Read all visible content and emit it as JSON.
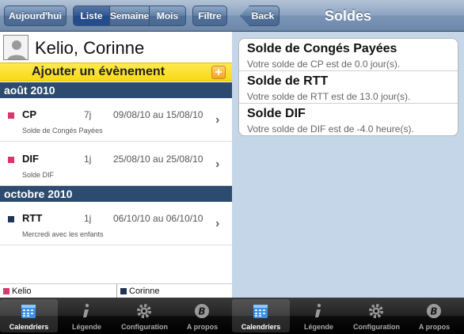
{
  "left": {
    "toolbar": {
      "today_label": "Aujourd'hui",
      "views": [
        "Liste",
        "Semaine",
        "Mois"
      ],
      "active_view": "Liste",
      "filter_label": "Filtre"
    },
    "person_name": "Kelio, Corinne",
    "add_event_label": "Ajouter un évènement",
    "add_plus_label": "+",
    "sections": [
      {
        "header": "août 2010",
        "events": [
          {
            "code": "CP",
            "days": "7j",
            "range": "09/08/10 au 15/08/10",
            "description": "Solde de Congés Payées",
            "color": "#d23a6a"
          },
          {
            "code": "DIF",
            "days": "1j",
            "range": "25/08/10 au 25/08/10",
            "description": "Solde DIF",
            "color": "#d23a6a"
          }
        ]
      },
      {
        "header": "octobre 2010",
        "events": [
          {
            "code": "RTT",
            "days": "1j",
            "range": "06/10/10 au 06/10/10",
            "description": "Mercredi avec les enfants",
            "color": "#1f3552"
          }
        ]
      }
    ],
    "legend": [
      {
        "label": "Kelio",
        "color": "#d23a6a"
      },
      {
        "label": "Corinne",
        "color": "#1f3552"
      }
    ]
  },
  "right": {
    "back_label": "Back",
    "title": "Soldes",
    "balances": [
      {
        "title": "Solde de Congés Payées",
        "subtitle": "Votre solde de CP est de 0.0 jour(s)."
      },
      {
        "title": "Solde de RTT",
        "subtitle": "Votre solde de RTT est de 13.0 jour(s)."
      },
      {
        "title": "Solde DIF",
        "subtitle": "Votre solde de DIF est de -4.0 heure(s)."
      }
    ]
  },
  "tabbar": {
    "tabs": [
      {
        "label": "Calendriers",
        "icon": "calendar-icon"
      },
      {
        "label": "Légende",
        "icon": "info-icon"
      },
      {
        "label": "Configuration",
        "icon": "gear-icon"
      },
      {
        "label": "A propos",
        "icon": "brand-b-icon"
      }
    ],
    "active": "Calendriers"
  }
}
